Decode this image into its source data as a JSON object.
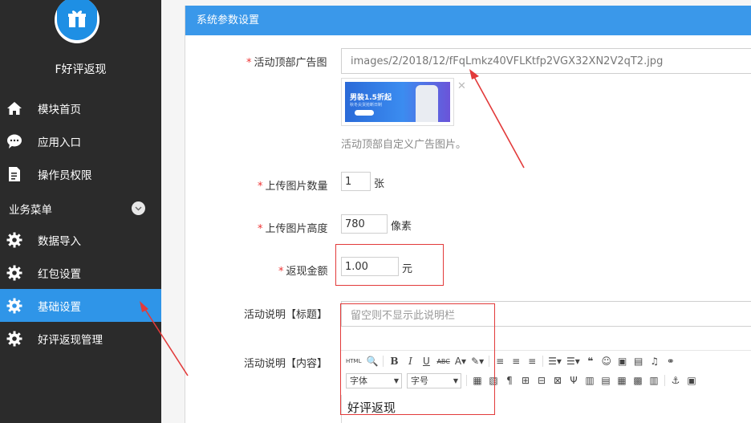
{
  "sidebar": {
    "app_name": "F好评返现",
    "items": [
      {
        "label": "模块首页",
        "icon": "home-icon"
      },
      {
        "label": "应用入口",
        "icon": "chat-icon"
      },
      {
        "label": "操作员权限",
        "icon": "document-icon"
      }
    ],
    "section": "业务菜单",
    "menu": [
      {
        "label": "数据导入",
        "icon": "gear-icon"
      },
      {
        "label": "红包设置",
        "icon": "gear-icon"
      },
      {
        "label": "基础设置",
        "icon": "gear-icon",
        "active": true
      },
      {
        "label": "好评返现管理",
        "icon": "gear-icon"
      }
    ]
  },
  "panel": {
    "title": "系统参数设置"
  },
  "form": {
    "ad_image": {
      "label": "活动顶部广告图",
      "value": "images/2/2018/12/fFqLmkz40VFLKtfp2VGX32XN2V2qT2.jpg",
      "hint": "活动顶部自定义广告图片。",
      "thumb_title": "男装1.5折起",
      "thumb_sub": "秋冬尖货抢断日制"
    },
    "upload_count": {
      "label": "上传图片数量",
      "value": "1",
      "unit": "张"
    },
    "upload_height": {
      "label": "上传图片高度",
      "value": "780",
      "unit": "像素"
    },
    "cashback": {
      "label": "返现金额",
      "value": "1.00",
      "unit": "元"
    },
    "desc_title": {
      "label": "活动说明【标题】",
      "placeholder": "留空则不显示此说明栏"
    },
    "desc_content": {
      "label": "活动说明【内容】",
      "font_select": "字体",
      "size_select": "字号",
      "html_label": "HTML",
      "body_text": "好评返现"
    }
  },
  "colors": {
    "sidebar_bg": "#2b2b2b",
    "accent": "#2f95e8",
    "panel_header": "#3a98ea",
    "required": "#e33333",
    "annotation": "#e23a3a"
  }
}
